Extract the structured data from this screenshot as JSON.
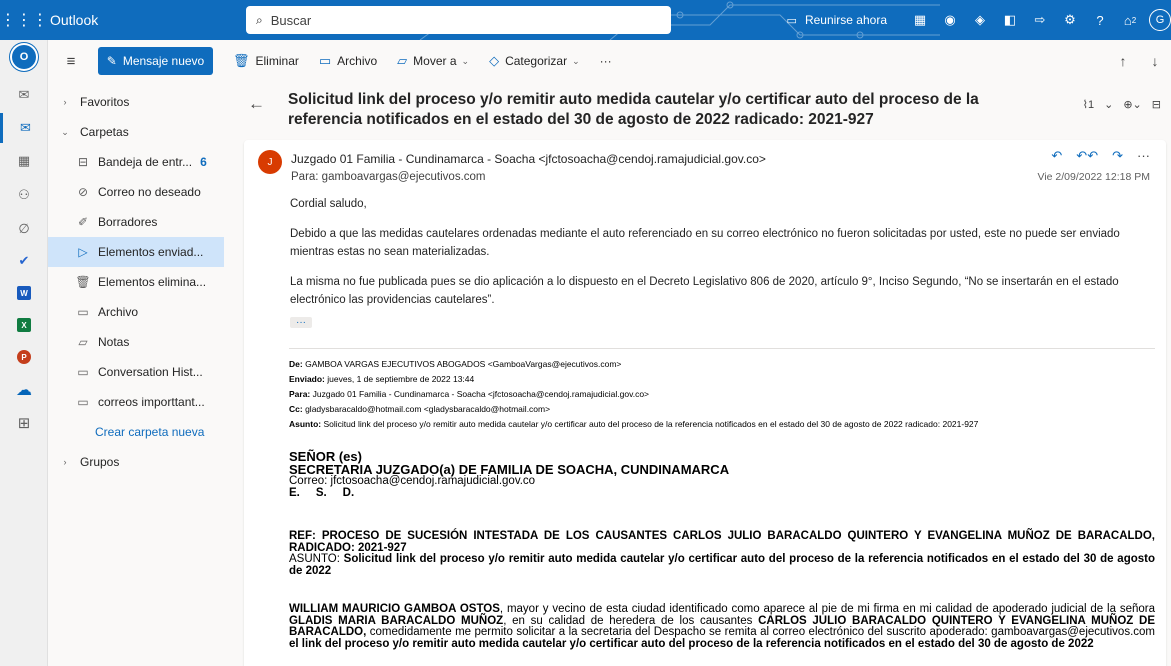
{
  "topbar": {
    "app_name": "Outlook",
    "search_placeholder": "Buscar",
    "meet_label": "Reunirse ahora",
    "notif_count": "2",
    "avatar_initial": "G"
  },
  "rail": {
    "logo": "O",
    "apps": [
      "mail-icon",
      "calendar-icon",
      "people-icon",
      "attach-icon",
      "todo-icon",
      "word-icon",
      "excel-icon",
      "powerpoint-icon",
      "onedrive-icon",
      "more-apps-icon"
    ]
  },
  "commands": {
    "new_mail": "Mensaje nuevo",
    "delete": "Eliminar",
    "archive": "Archivo",
    "move": "Mover a",
    "categorize": "Categorizar",
    "more": "···"
  },
  "folders": {
    "favorites": "Favoritos",
    "folders_header": "Carpetas",
    "items": [
      {
        "label": "Bandeja de entr...",
        "count": "6"
      },
      {
        "label": "Correo no deseado"
      },
      {
        "label": "Borradores"
      },
      {
        "label": "Elementos enviad..."
      },
      {
        "label": "Elementos elimina..."
      },
      {
        "label": "Archivo"
      },
      {
        "label": "Notas"
      },
      {
        "label": "Conversation Hist..."
      },
      {
        "label": "correos importtant..."
      }
    ],
    "new_folder": "Crear carpeta nueva",
    "groups": "Grupos"
  },
  "message": {
    "subject": "Solicitud link del proceso y/o remitir auto medida cautelar y/o certificar auto del proceso de la referencia notificados en el estado del 30 de agosto de 2022 radicado: 2021-927",
    "attach_count": "1",
    "sender_initial": "J",
    "from": "Juzgado 01 Familia - Cundinamarca - Soacha <jfctosoacha@cendoj.ramajudicial.gov.co>",
    "to": "Para: gamboavargas@ejecutivos.com",
    "date": "Vie 2/09/2022 12:18 PM",
    "greeting": "Cordial saludo,",
    "para1": "Debido a que las medidas cautelares ordenadas mediante el auto referenciado en su correo electrónico no fueron solicitadas por usted, este no puede ser enviado mientras estas no sean materializadas.",
    "para2": "La misma no fue publicada pues se dio aplicación a lo dispuesto en el Decreto Legislativo 806 de 2020, artículo 9°, Inciso Segundo, “No se insertarán en el estado electrónico las providencias cautelares”.",
    "expand": "···"
  },
  "forwarded": {
    "de_label": "De:",
    "de": "GAMBOA VARGAS EJECUTIVOS ABOGADOS <GamboaVargas@ejecutivos.com>",
    "enviado_label": "Enviado:",
    "enviado": "jueves, 1 de septiembre de 2022 13:44",
    "para_label": "Para:",
    "para": "Juzgado 01 Familia - Cundinamarca - Soacha <jfctosoacha@cendoj.ramajudicial.gov.co>",
    "cc_label": "Cc:",
    "cc": "gladysbaracaldo@hotmail.com <gladysbaracaldo@hotmail.com>",
    "asunto_label": "Asunto:",
    "asunto": "Solicitud link del proceso y/o remitir auto medida cautelar y/o certificar auto del proceso de la referencia notificados en el estado del 30 de agosto de 2022 radicado: 2021-927"
  },
  "letter": {
    "addr1": "SEÑOR (es)",
    "addr2": "SECRETARIA JUZGADO(a) DE FAMILIA DE SOACHA, CUNDINAMARCA",
    "addr3": "Correo: jfctosoacha@cendoj.ramajudicial.gov.co",
    "addr4": "E.     S.     D.",
    "ref": "REF: PROCESO DE SUCESIÓN INTESTADA DE LOS CAUSANTES CARLOS JULIO BARACALDO QUINTERO Y EVANGELINA MUÑOZ DE BARACALDO, RADICADO: 2021-927",
    "asunto_label": "ASUNTO: ",
    "asunto": "Solicitud link del proceso y/o remitir auto medida cautelar y/o certificar auto del proceso de la referencia notificados en el estado del 30 de agosto de 2022",
    "p_name": "WILLIAM MAURICIO GAMBOA OSTOS",
    "p_text1": ", mayor y vecino de esta ciudad identificado como aparece al pie de mi firma en mi calidad de apoderado judicial de la señora ",
    "p_client": "GLADIS MARIA BARACALDO MUÑOZ",
    "p_text2": ", en su calidad de heredera de los causantes ",
    "p_causantes": "CARLOS JULIO BARACALDO QUINTERO Y EVANGELINA MUÑOZ DE BARACALDO,",
    "p_text3": " comedidamente me permito solicitar a la secretaria del Despacho se remita al correo electrónico del suscrito apoderado: gamboavargas@ejecutivos.com ",
    "p_bold_end": "el link del proceso y/o remitir auto medida cautelar y/o certificar auto del proceso de la referencia notificados en el estado del 30 de agosto de 2022"
  }
}
